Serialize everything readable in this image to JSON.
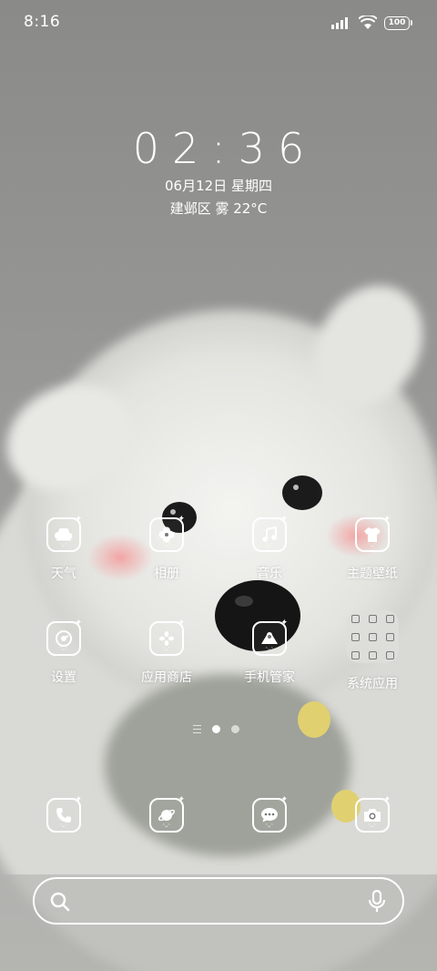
{
  "status_bar": {
    "time": "8:16",
    "battery": "100",
    "icons": [
      "signal-icon",
      "wifi-icon",
      "battery-icon"
    ]
  },
  "clock_widget": {
    "time": "02:36",
    "date": "06月12日 星期四",
    "weather": "建邺区 雾 22°C"
  },
  "apps": [
    {
      "label": "天气",
      "icon": "weather-cloud-icon"
    },
    {
      "label": "相册",
      "icon": "gallery-clover-icon"
    },
    {
      "label": "音乐",
      "icon": "music-note-icon"
    },
    {
      "label": "主题壁纸",
      "icon": "theme-shirt-icon"
    },
    {
      "label": "设置",
      "icon": "settings-icon"
    },
    {
      "label": "应用商店",
      "icon": "app-store-icon"
    },
    {
      "label": "手机管家",
      "icon": "security-icon"
    },
    {
      "label": "系统应用",
      "icon": "folder-icon"
    }
  ],
  "pager": {
    "pages": 2,
    "active": 1
  },
  "dock": [
    {
      "icon": "phone-icon"
    },
    {
      "icon": "browser-planet-icon"
    },
    {
      "icon": "messages-icon"
    },
    {
      "icon": "camera-icon"
    }
  ],
  "search_bar": {
    "icons": [
      "search-icon",
      "microphone-icon"
    ]
  },
  "colors": {
    "foreground": "#ffffff",
    "wallpaper_base": "#8d8d8b",
    "folder_bg": "#dedeDA"
  }
}
